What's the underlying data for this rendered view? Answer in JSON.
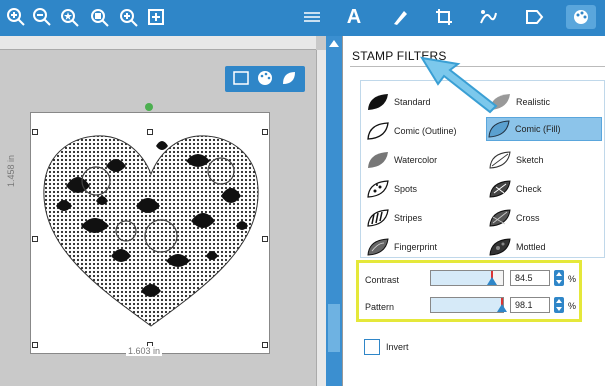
{
  "toolbar": {
    "left_icons": [
      "zoom-in-icon",
      "zoom-out-icon",
      "zoom-fit-icon",
      "zoom-selection-icon",
      "pan-icon",
      "fit-page-icon"
    ],
    "right_icons": [
      "lines-icon",
      "text-icon",
      "draw-icon",
      "crop-icon",
      "trace-icon",
      "send-icon",
      "palette-icon"
    ],
    "text_tool_label": "A"
  },
  "canvas": {
    "height_dimension": "1.458 in",
    "width_dimension": "1.603 in"
  },
  "panel": {
    "title": "STAMP FILTERS",
    "filters": [
      {
        "label": "Standard",
        "selected": false
      },
      {
        "label": "Realistic",
        "selected": false
      },
      {
        "label": "Comic (Outline)",
        "selected": false
      },
      {
        "label": "Comic (Fill)",
        "selected": true
      },
      {
        "label": "Watercolor",
        "selected": false
      },
      {
        "label": "Sketch",
        "selected": false
      },
      {
        "label": "Spots",
        "selected": false
      },
      {
        "label": "Check",
        "selected": false
      },
      {
        "label": "Stripes",
        "selected": false
      },
      {
        "label": "Cross",
        "selected": false
      },
      {
        "label": "Fingerprint",
        "selected": false
      },
      {
        "label": "Mottled",
        "selected": false
      }
    ],
    "contrast": {
      "label": "Contrast",
      "value": "84.5",
      "unit": "%",
      "fraction": 0.845
    },
    "pattern": {
      "label": "Pattern",
      "value": "98.1",
      "unit": "%",
      "fraction": 0.981
    },
    "invert_label": "Invert"
  },
  "colors": {
    "toolbar_blue": "#2f86c8",
    "selected_filter": "#8cc4ea",
    "highlight_yellow": "#e5e83a"
  }
}
